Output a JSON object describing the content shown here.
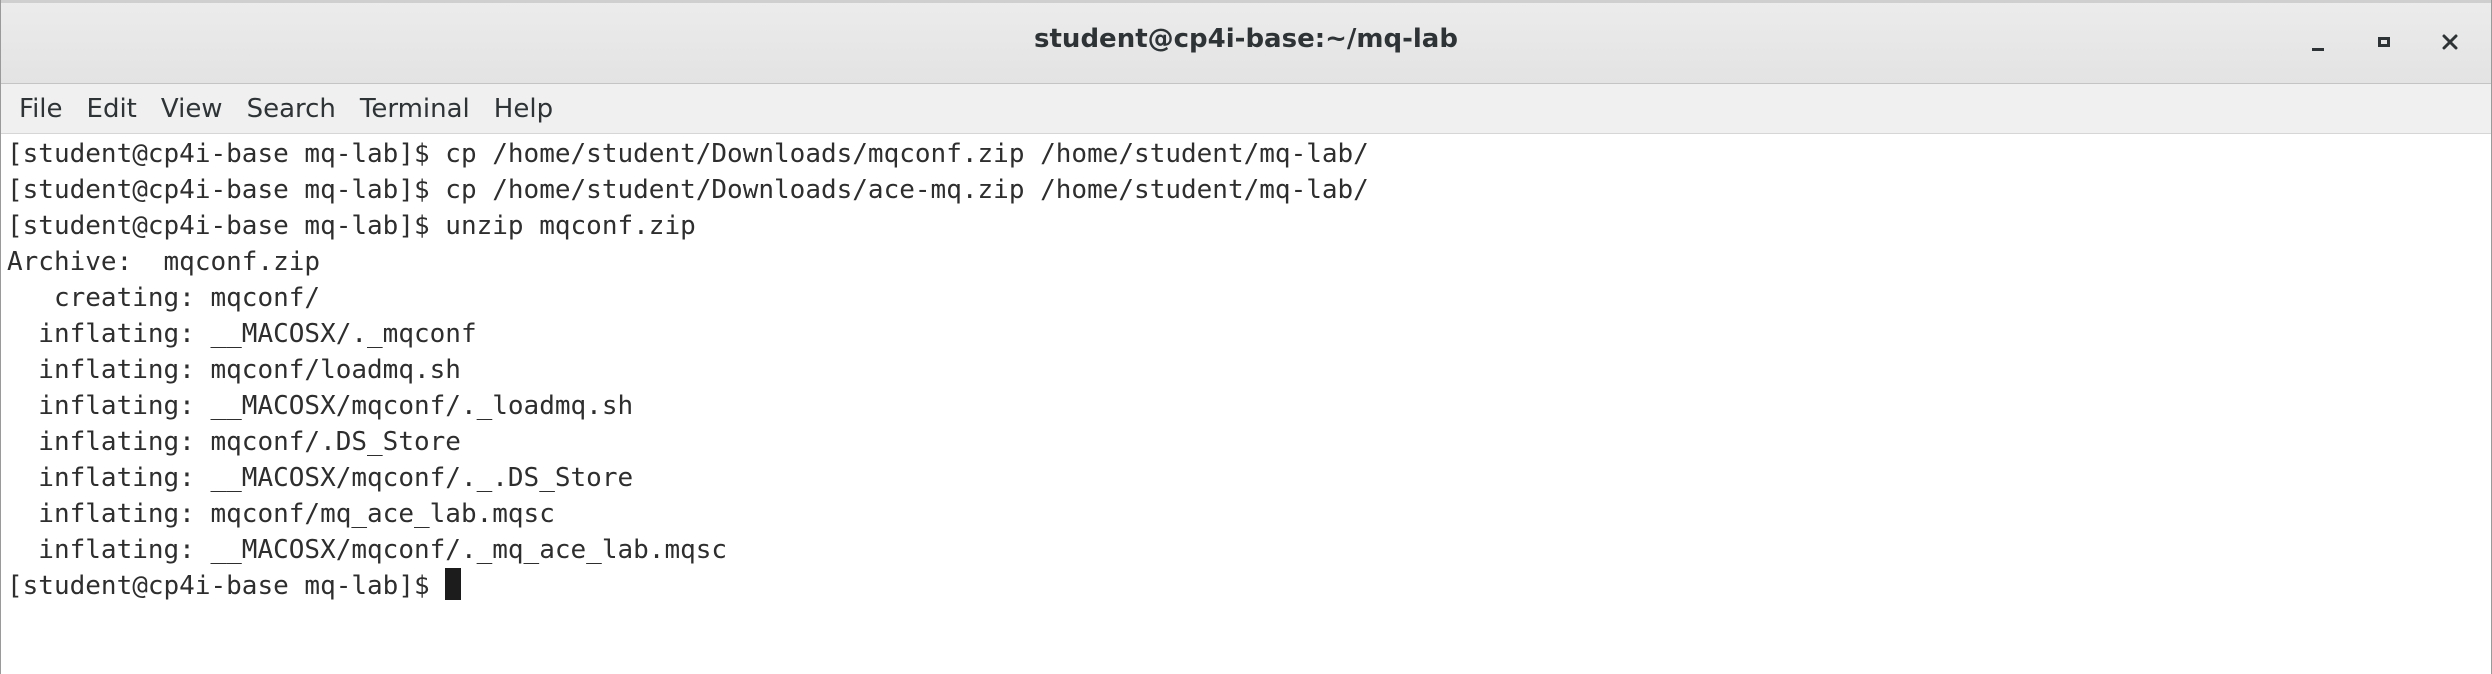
{
  "window": {
    "title": "student@cp4i-base:~/mq-lab"
  },
  "menu": {
    "items": [
      "File",
      "Edit",
      "View",
      "Search",
      "Terminal",
      "Help"
    ]
  },
  "terminal": {
    "lines": [
      "[student@cp4i-base mq-lab]$ cp /home/student/Downloads/mqconf.zip /home/student/mq-lab/",
      "[student@cp4i-base mq-lab]$ cp /home/student/Downloads/ace-mq.zip /home/student/mq-lab/",
      "[student@cp4i-base mq-lab]$ unzip mqconf.zip",
      "Archive:  mqconf.zip",
      "   creating: mqconf/",
      "  inflating: __MACOSX/._mqconf",
      "  inflating: mqconf/loadmq.sh",
      "  inflating: __MACOSX/mqconf/._loadmq.sh",
      "  inflating: mqconf/.DS_Store",
      "  inflating: __MACOSX/mqconf/._.DS_Store",
      "  inflating: mqconf/mq_ace_lab.mqsc",
      "  inflating: __MACOSX/mqconf/._mq_ace_lab.mqsc"
    ],
    "prompt": "[student@cp4i-base mq-lab]$ "
  },
  "icons": {
    "minimize": "minimize-icon",
    "maximize": "maximize-icon",
    "close": "close-icon"
  }
}
